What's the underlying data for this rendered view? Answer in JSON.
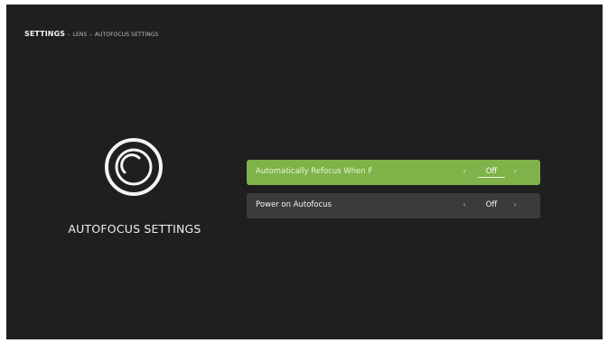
{
  "breadcrumb": {
    "root": "SETTINGS",
    "separator": "–",
    "level1": "LENS",
    "level2": "AUTOFOCUS SETTINGS"
  },
  "panel": {
    "icon": "autofocus-icon",
    "title": "AUTOFOCUS SETTINGS"
  },
  "options": [
    {
      "label": "Automatically Refocus When F",
      "value": "Off",
      "selected": true,
      "left_arrow": "‹",
      "right_arrow": "›"
    },
    {
      "label": "Power on Autofocus",
      "value": "Off",
      "selected": false,
      "left_arrow": "‹",
      "right_arrow": "›"
    }
  ],
  "colors": {
    "background": "#1e1f1e",
    "selected_row": "#7fb248",
    "row": "#3a3b3a",
    "text": "#f2f2f2"
  }
}
